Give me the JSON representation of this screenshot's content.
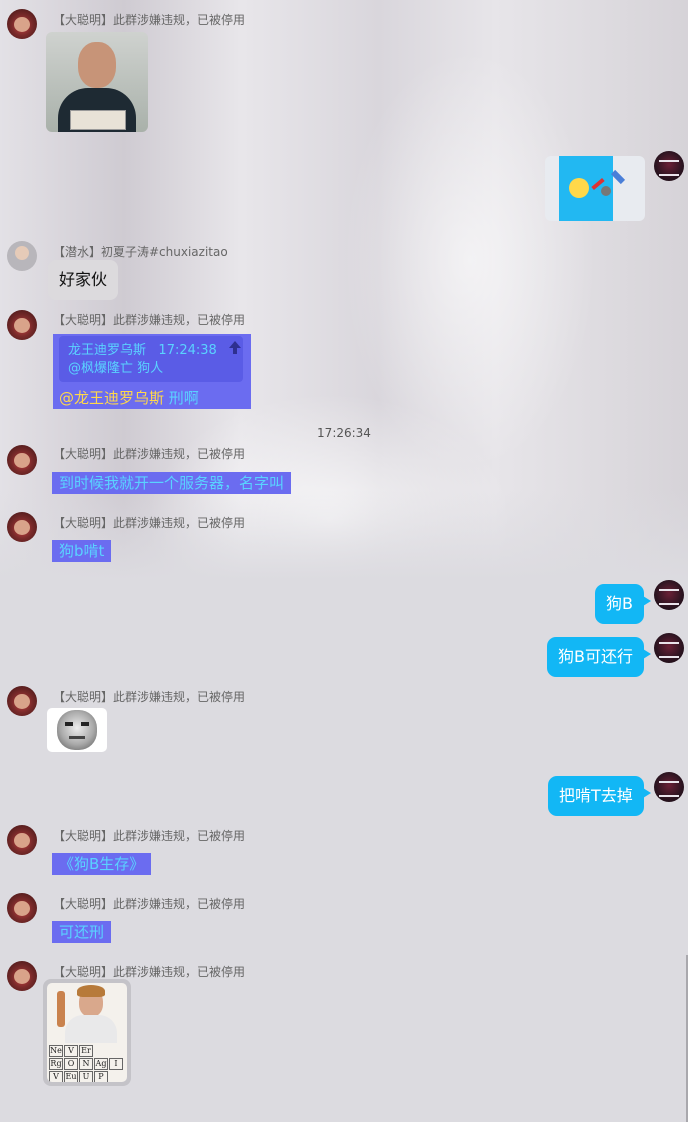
{
  "messages": {
    "m1": {
      "sender": "【大聪明】此群涉嫌违规，已被停用"
    },
    "m3": {
      "sender": "【潜水】初夏子涛#chuxiazitao",
      "text": "好家伙"
    },
    "m4": {
      "sender": "【大聪明】此群涉嫌违规，已被停用",
      "quote_name": "龙王迪罗乌斯",
      "quote_time": "17:24:38",
      "quote_text": "@枫爆隆亡 狗人",
      "mention": "@龙王迪罗乌斯",
      "text": "刑啊"
    },
    "timestamp": "17:26:34",
    "m5": {
      "sender": "【大聪明】此群涉嫌违规，已被停用",
      "text": "到时候我就开一个服务器，名字叫"
    },
    "m6": {
      "sender": "【大聪明】此群涉嫌违规，已被停用",
      "text": "狗b啃t"
    },
    "m7": {
      "text": "狗B"
    },
    "m8": {
      "text": "狗B可还行"
    },
    "m9": {
      "sender": "【大聪明】此群涉嫌违规，已被停用"
    },
    "m10": {
      "text": "把啃T去掉"
    },
    "m11": {
      "sender": "【大聪明】此群涉嫌违规，已被停用",
      "text": "《狗B生存》"
    },
    "m12": {
      "sender": "【大聪明】此群涉嫌违规，已被停用",
      "text": "可还刑"
    },
    "m13": {
      "sender": "【大聪明】此群涉嫌违规，已被停用",
      "periodic_cells": [
        "Ne",
        "V",
        "Er",
        "Rg",
        "O",
        "N",
        "Ag",
        "I",
        "V",
        "Eu",
        "U",
        "P"
      ]
    }
  },
  "colors": {
    "self_bubble": "#12b7f5",
    "purple_bubble": "#6b6cf0",
    "purple_text": "#5ad2ff",
    "mention": "#ffd84a"
  }
}
